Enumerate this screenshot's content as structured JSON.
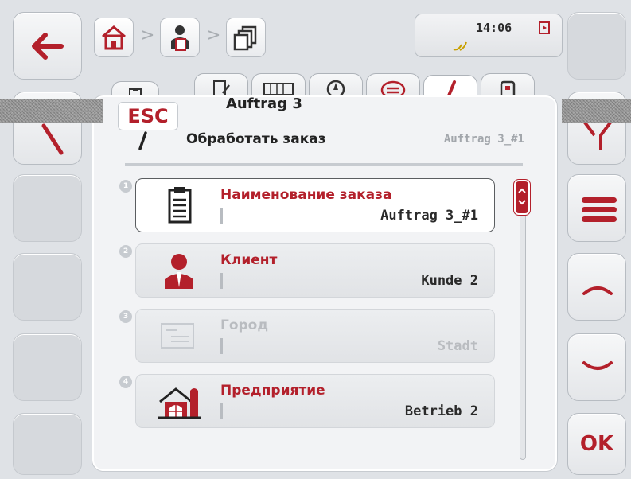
{
  "header": {
    "time": "14:06",
    "breadcrumb": [
      "home-icon",
      "operator-icon",
      "task-list-icon"
    ]
  },
  "tabs": [
    "clipboard-icon",
    "document-edit-icon",
    "counter-icon",
    "navigation-icon",
    "list-icon",
    "pen-icon",
    "storage-icon"
  ],
  "esc_label": "ESC",
  "task_title": "Auftrag 3",
  "edit": {
    "title": "Обработать заказ",
    "subtitle": "Auftrag 3_#1"
  },
  "items": [
    {
      "index": "1",
      "label": "Наименование заказа",
      "value": "Auftrag 3_#1",
      "icon": "clipboard-icon",
      "state": "selected"
    },
    {
      "index": "2",
      "label": "Клиент",
      "value": "Kunde 2",
      "icon": "customer-icon",
      "state": "enabled"
    },
    {
      "index": "3",
      "label": "Город",
      "value": "Stadt",
      "icon": "address-icon",
      "state": "disabled"
    },
    {
      "index": "4",
      "label": "Предприятие",
      "value": "Betrieb 2",
      "icon": "farm-icon",
      "state": "enabled"
    }
  ],
  "right_buttons": [
    "filter-icon",
    "menu-icon",
    "arrow-up-icon",
    "arrow-down-icon"
  ],
  "ok_label": "OK",
  "colors": {
    "accent": "#b3202b",
    "background": "#dfe2e6"
  }
}
